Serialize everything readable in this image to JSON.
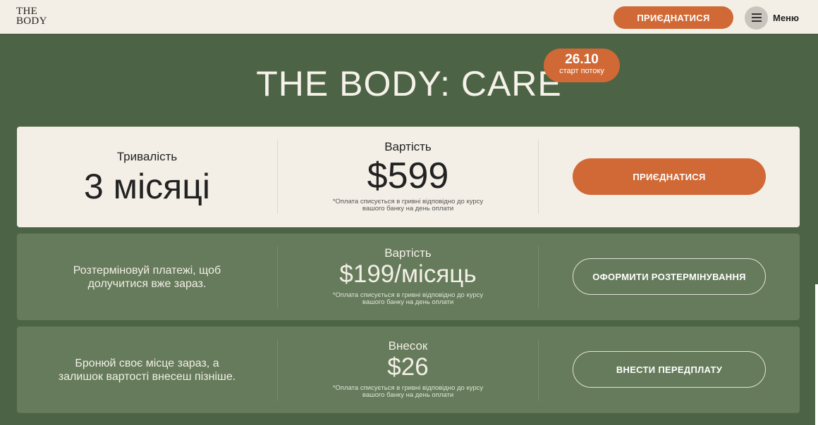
{
  "header": {
    "logo_line1": "THE",
    "logo_line2": "BODY",
    "join_label": "ПРИЄДНАТИСЯ",
    "menu_label": "Меню"
  },
  "hero": {
    "title": "THE BODY: CARE",
    "badge_date": "26.10",
    "badge_sub": "старт потоку"
  },
  "plans": {
    "main": {
      "duration_label": "Тривалість",
      "duration_value": "3 місяці",
      "price_label": "Вартість",
      "price_value": "$599",
      "note_line1": "*Оплата списується в гривні відповідно до курсу",
      "note_line2": "вашого банку на день оплати",
      "button": "ПРИЄДНАТИСЯ"
    },
    "installment": {
      "desc_line1": "Розтерміновуй платежі, щоб",
      "desc_line2": "долучитися вже зараз.",
      "price_label": "Вартість",
      "price_value": "$199/місяць",
      "note_line1": "*Оплата списується в гривні відповідно до курсу",
      "note_line2": "вашого банку на день оплати",
      "button": "ОФОРМИТИ РОЗТЕРМІНУВАННЯ"
    },
    "deposit": {
      "desc_line1": "Бронюй своє місце зараз, а",
      "desc_line2": "залишок вартості внесеш пізніше.",
      "price_label": "Внесок",
      "price_value": "$26",
      "note_line1": "*Оплата списується в гривні відповідно до курсу",
      "note_line2": "вашого банку на день оплати",
      "button": "ВНЕСТИ ПЕРЕДПЛАТУ"
    }
  },
  "colors": {
    "accent": "#d06935",
    "background": "#4c6445",
    "card_light": "#f3efe6",
    "card_green": "#657b5b"
  }
}
